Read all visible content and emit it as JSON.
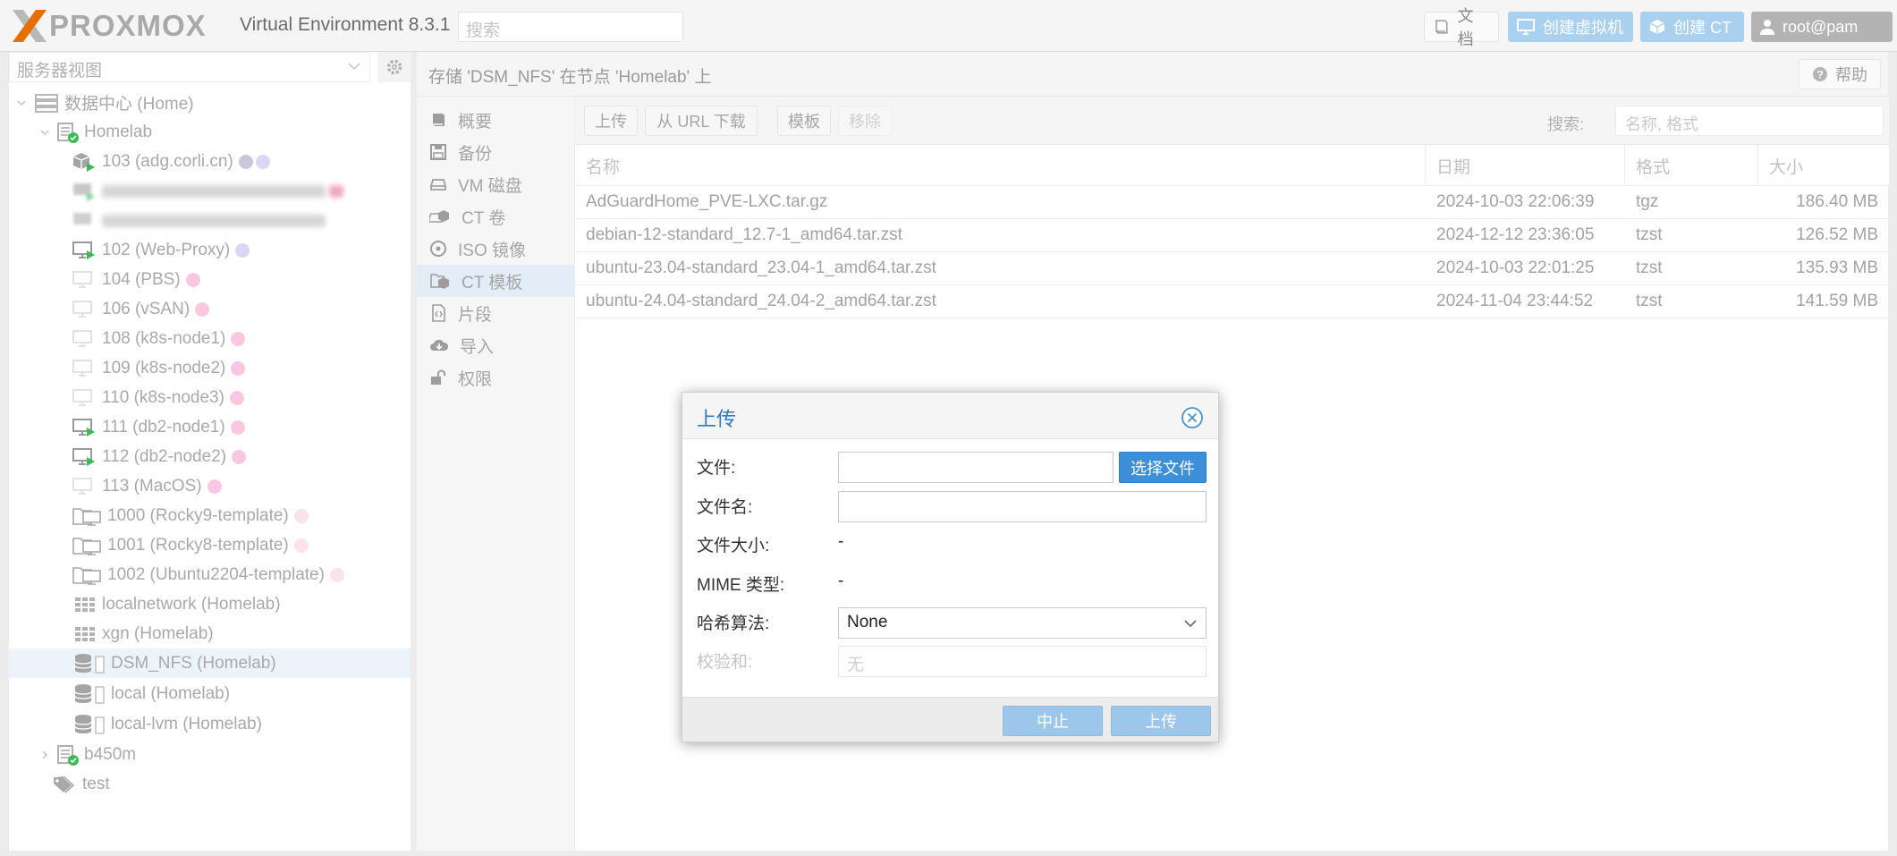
{
  "topbar": {
    "brand": "PROXMOX",
    "version": "Virtual Environment 8.3.1",
    "search_placeholder": "搜索",
    "docs_label": "文档",
    "create_vm_label": "创建虚拟机",
    "create_ct_label": "创建 CT",
    "user_label": "root@pam"
  },
  "sidebar": {
    "view_select": "服务器视图",
    "tree": [
      {
        "label": "数据中心 (Home)",
        "icon": "datacenter-icon"
      },
      {
        "label": "Homelab",
        "icon": "node-online-icon"
      },
      {
        "label": "103 (adg.corli.cn)",
        "icon": "container-running-icon"
      },
      {
        "label": "",
        "icon": "vm-running-icon",
        "blurred": true
      },
      {
        "label": "",
        "icon": "vm-icon",
        "blurred": true
      },
      {
        "label": "102 (Web-Proxy)",
        "icon": "vm-running-icon"
      },
      {
        "label": "104 (PBS)",
        "icon": "vm-stopped-icon"
      },
      {
        "label": "106 (vSAN)",
        "icon": "vm-stopped-icon"
      },
      {
        "label": "108 (k8s-node1)",
        "icon": "vm-stopped-icon"
      },
      {
        "label": "109 (k8s-node2)",
        "icon": "vm-stopped-icon"
      },
      {
        "label": "110 (k8s-node3)",
        "icon": "vm-stopped-icon"
      },
      {
        "label": "111 (db2-node1)",
        "icon": "vm-running-icon"
      },
      {
        "label": "112 (db2-node2)",
        "icon": "vm-running-icon"
      },
      {
        "label": "113 (MacOS)",
        "icon": "vm-stopped-icon"
      },
      {
        "label": "1000 (Rocky9-template)",
        "icon": "template-icon"
      },
      {
        "label": "1001 (Rocky8-template)",
        "icon": "template-icon"
      },
      {
        "label": "1002 (Ubuntu2204-template)",
        "icon": "template-icon"
      },
      {
        "label": "localnetwork (Homelab)",
        "icon": "sdn-icon"
      },
      {
        "label": "xgn (Homelab)",
        "icon": "sdn-icon"
      },
      {
        "label": "DSM_NFS (Homelab)",
        "icon": "storage-icon"
      },
      {
        "label": "local (Homelab)",
        "icon": "storage-icon"
      },
      {
        "label": "local-lvm (Homelab)",
        "icon": "storage-icon"
      },
      {
        "label": "b450m",
        "icon": "node-online-icon"
      },
      {
        "label": "test",
        "icon": "tag-icon"
      }
    ]
  },
  "content": {
    "title": "存储 'DSM_NFS' 在节点 'Homelab' 上",
    "help_label": "帮助",
    "nav": [
      {
        "label": "概要",
        "icon": "book-icon"
      },
      {
        "label": "备份",
        "icon": "floppy-icon"
      },
      {
        "label": "VM 磁盘",
        "icon": "hdd-icon"
      },
      {
        "label": "CT 卷",
        "icon": "ct-volume-icon"
      },
      {
        "label": "ISO 镜像",
        "icon": "disc-icon"
      },
      {
        "label": "CT 模板",
        "icon": "ct-template-icon"
      },
      {
        "label": "片段",
        "icon": "snippet-icon"
      },
      {
        "label": "导入",
        "icon": "cloud-download-icon"
      },
      {
        "label": "权限",
        "icon": "unlock-icon"
      }
    ],
    "toolbar": {
      "upload_label": "上传",
      "download_url_label": "从 URL 下载",
      "templates_label": "模板",
      "remove_label": "移除",
      "search_label": "搜索:",
      "search_placeholder": "名称, 格式"
    },
    "table": {
      "columns": [
        "名称",
        "日期",
        "格式",
        "大小"
      ],
      "rows": [
        [
          "AdGuardHome_PVE-LXC.tar.gz",
          "2024-10-03 22:06:39",
          "tgz",
          "186.40 MB"
        ],
        [
          "debian-12-standard_12.7-1_amd64.tar.zst",
          "2024-12-12 23:36:05",
          "tzst",
          "126.52 MB"
        ],
        [
          "ubuntu-23.04-standard_23.04-1_amd64.tar.zst",
          "2024-10-03 22:01:25",
          "tzst",
          "135.93 MB"
        ],
        [
          "ubuntu-24.04-standard_24.04-2_amd64.tar.zst",
          "2024-11-04 23:44:52",
          "tzst",
          "141.59 MB"
        ]
      ]
    }
  },
  "dialog": {
    "title": "上传",
    "file_label": "文件:",
    "file_value": "",
    "choose_file_label": "选择文件",
    "filename_label": "文件名:",
    "filename_value": "",
    "filesize_label": "文件大小:",
    "filesize_value": "-",
    "mime_label": "MIME 类型:",
    "mime_value": "-",
    "hash_label": "哈希算法:",
    "hash_value": "None",
    "checksum_label": "校验和:",
    "checksum_placeholder": "无",
    "abort_label": "中止",
    "upload_label": "上传"
  },
  "colors": {
    "accent": "#3d8fd8",
    "brand_orange": "#e57000",
    "running_green": "#3cba54",
    "tag_lavender": "#d3d3f2",
    "tag_pink": "#f9c8e0"
  }
}
